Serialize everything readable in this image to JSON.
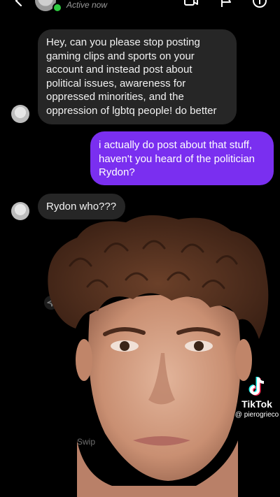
{
  "header": {
    "status": "Active now"
  },
  "messages": [
    {
      "from": "them",
      "text": "Hey, can you please stop posting gaming clips and sports on your account and instead post about political issues, awareness for oppressed minorities, and the oppression of lgbtq people! do better"
    },
    {
      "from": "me",
      "text": "i actually do post about that stuff, haven't you heard of the politician Rydon?"
    },
    {
      "from": "them",
      "text": "Rydon who???"
    }
  ],
  "swipe_hint": "Swip",
  "watermark": {
    "brand": "TikTok",
    "username": "@ pierogrieco"
  },
  "colors": {
    "outgoing_bubble": "#7a2ff0",
    "incoming_bubble": "#262626",
    "online": "#2ecc40"
  }
}
